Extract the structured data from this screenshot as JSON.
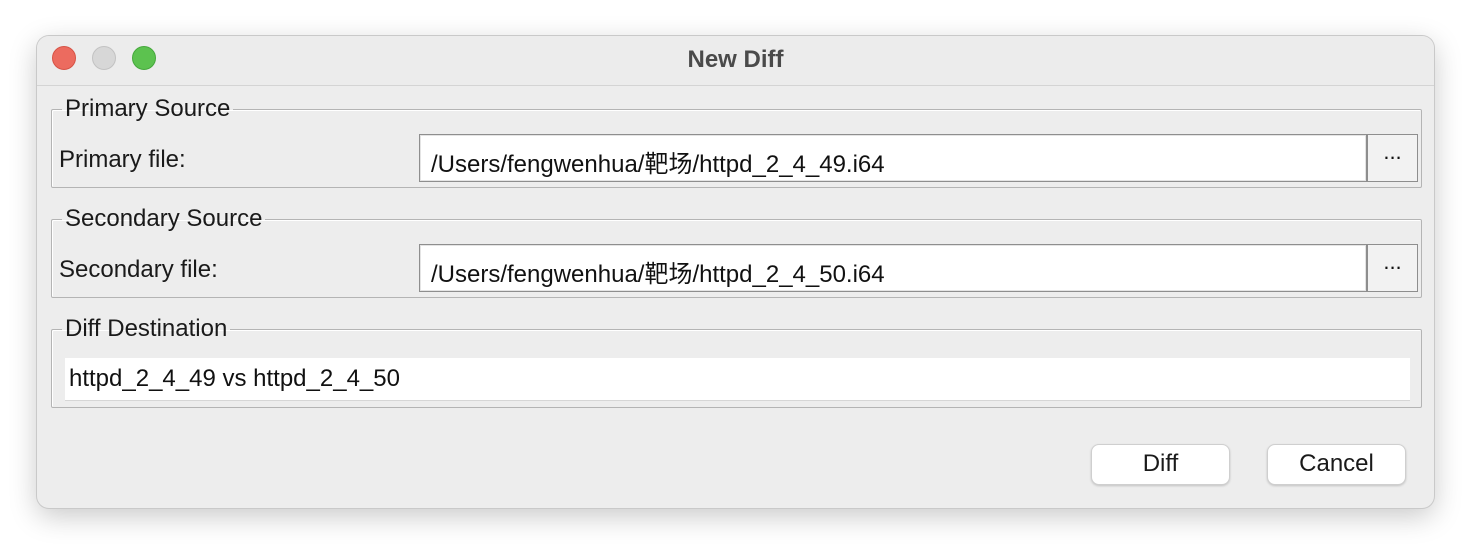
{
  "window": {
    "title": "New Diff"
  },
  "primary": {
    "legend": "Primary Source",
    "label": "Primary file:",
    "value": "/Users/fengwenhua/靶场/httpd_2_4_49.i64",
    "browse_label": "..."
  },
  "secondary": {
    "legend": "Secondary Source",
    "label": "Secondary file:",
    "value": "/Users/fengwenhua/靶场/httpd_2_4_50.i64",
    "browse_label": "..."
  },
  "destination": {
    "legend": "Diff Destination",
    "value": "httpd_2_4_49 vs httpd_2_4_50"
  },
  "buttons": {
    "diff": "Diff",
    "cancel": "Cancel"
  }
}
